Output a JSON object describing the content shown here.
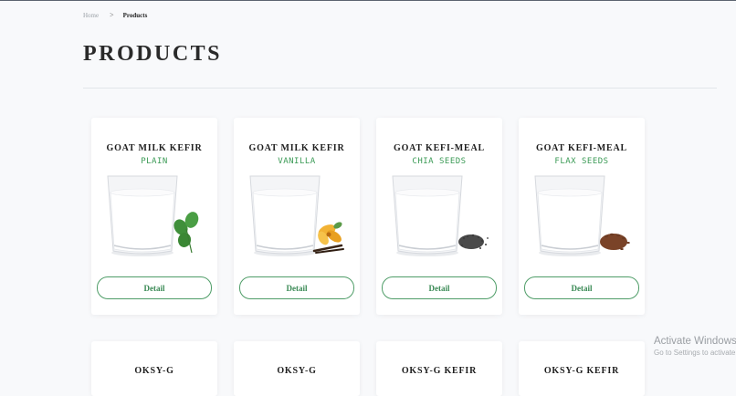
{
  "breadcrumb": {
    "home": "Home",
    "separator": ">",
    "current": "Products"
  },
  "page": {
    "title": "PRODUCTS"
  },
  "products": [
    {
      "name": "GOAT MILK KEFIR",
      "variant": "PLAIN",
      "button": "Detail",
      "garnish": "clover-leaves"
    },
    {
      "name": "GOAT MILK KEFIR",
      "variant": "VANILLA",
      "button": "Detail",
      "garnish": "vanilla-flower"
    },
    {
      "name": "GOAT KEFI-MEAL",
      "variant": "CHIA SEEDS",
      "button": "Detail",
      "garnish": "chia-seeds"
    },
    {
      "name": "GOAT KEFI-MEAL",
      "variant": "FLAX SEEDS",
      "button": "Detail",
      "garnish": "flax-seeds"
    }
  ],
  "products_row2": [
    {
      "name": "OKSY-G"
    },
    {
      "name": "OKSY-G"
    },
    {
      "name": "OKSY-G KEFIR"
    },
    {
      "name": "OKSY-G KEFIR"
    }
  ],
  "watermark": {
    "title": "Activate Windows",
    "subtitle": "Go to Settings to activate Windows."
  },
  "colors": {
    "accent": "#3a9a55",
    "background": "#f8f9fb",
    "card": "#ffffff"
  }
}
